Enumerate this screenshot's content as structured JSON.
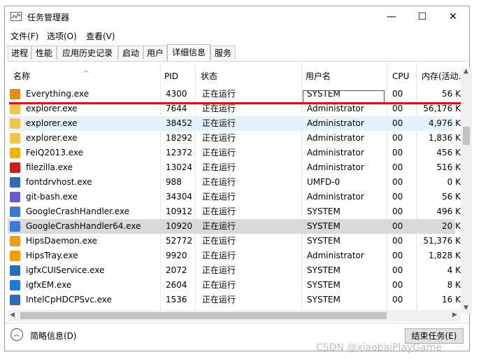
{
  "window": {
    "title": "任务管理器",
    "controls": [
      "—",
      "☐",
      "✕"
    ]
  },
  "menu": [
    "文件(F)",
    "选项(O)",
    "查看(V)"
  ],
  "tabs": [
    "进程",
    "性能",
    "应用历史记录",
    "启动",
    "用户",
    "详细信息",
    "服务"
  ],
  "active_tab_index": 5,
  "columns": [
    "名称",
    "PID",
    "状态",
    "用户名",
    "CPU",
    "内存(活动..."
  ],
  "processes": [
    {
      "name": "Everything.exe",
      "pid": "4300",
      "status": "正在运行",
      "user": "SYSTEM",
      "cpu": "00",
      "memory": "56 K",
      "icon": "everything-icon",
      "icon_color": "#e98a1a"
    },
    {
      "name": "explorer.exe",
      "pid": "7644",
      "status": "正在运行",
      "user": "Administrator",
      "cpu": "00",
      "memory": "56,176 K",
      "icon": "folder-icon",
      "icon_color": "#f2c44b"
    },
    {
      "name": "explorer.exe",
      "pid": "38452",
      "status": "正在运行",
      "user": "Administrator",
      "cpu": "00",
      "memory": "4,976 K",
      "icon": "folder-icon",
      "icon_color": "#f2c44b"
    },
    {
      "name": "explorer.exe",
      "pid": "18292",
      "status": "正在运行",
      "user": "Administrator",
      "cpu": "00",
      "memory": "1,836 K",
      "icon": "folder-icon",
      "icon_color": "#f2c44b"
    },
    {
      "name": "FeiQ2013.exe",
      "pid": "12372",
      "status": "正在运行",
      "user": "Administrator",
      "cpu": "00",
      "memory": "456 K",
      "icon": "feiq-icon",
      "icon_color": "#f0b400"
    },
    {
      "name": "filezilla.exe",
      "pid": "13024",
      "status": "正在运行",
      "user": "Administrator",
      "cpu": "00",
      "memory": "516 K",
      "icon": "filezilla-icon",
      "icon_color": "#c8201e"
    },
    {
      "name": "fontdrvhost.exe",
      "pid": "988",
      "status": "正在运行",
      "user": "UMFD-0",
      "cpu": "00",
      "memory": "0 K",
      "icon": "window-icon",
      "icon_color": "#2b6cb8"
    },
    {
      "name": "git-bash.exe",
      "pid": "34304",
      "status": "正在运行",
      "user": "Administrator",
      "cpu": "00",
      "memory": "56 K",
      "icon": "git-icon",
      "icon_color": "#6a5acd"
    },
    {
      "name": "GoogleCrashHandler.exe",
      "pid": "10912",
      "status": "正在运行",
      "user": "SYSTEM",
      "cpu": "00",
      "memory": "496 K",
      "icon": "google-icon",
      "icon_color": "#3a7bd5"
    },
    {
      "name": "GoogleCrashHandler64.exe",
      "pid": "10920",
      "status": "正在运行",
      "user": "SYSTEM",
      "cpu": "00",
      "memory": "20 K",
      "icon": "google-icon",
      "icon_color": "#3a7bd5"
    },
    {
      "name": "HipsDaemon.exe",
      "pid": "52772",
      "status": "正在运行",
      "user": "SYSTEM",
      "cpu": "00",
      "memory": "51,376 K",
      "icon": "hips-icon",
      "icon_color": "#f39c12"
    },
    {
      "name": "HipsTray.exe",
      "pid": "9920",
      "status": "正在运行",
      "user": "Administrator",
      "cpu": "00",
      "memory": "1,828 K",
      "icon": "hips-icon",
      "icon_color": "#f39c12"
    },
    {
      "name": "igfxCUIService.exe",
      "pid": "2072",
      "status": "正在运行",
      "user": "SYSTEM",
      "cpu": "00",
      "memory": "4 K",
      "icon": "window-icon",
      "icon_color": "#2b6cb8"
    },
    {
      "name": "igfxEM.exe",
      "pid": "2604",
      "status": "正在运行",
      "user": "SYSTEM",
      "cpu": "00",
      "memory": "8 K",
      "icon": "intel-icon",
      "icon_color": "#1f7bd3"
    },
    {
      "name": "IntelCpHDCPSvc.exe",
      "pid": "1536",
      "status": "正在运行",
      "user": "SYSTEM",
      "cpu": "00",
      "memory": "16 K",
      "icon": "window-icon",
      "icon_color": "#2b6cb8"
    }
  ],
  "selected_row_index": 9,
  "hover_row_index": 2,
  "footer": {
    "fewer_details": "简略信息(D)",
    "end_task": "结束任务(E)"
  },
  "watermark": "CSDN @xiaobaiPlayGame",
  "colors": {
    "annotation_red": "#e0101a",
    "selected_row": "#dadada",
    "hover_row": "#e5f1fb"
  }
}
